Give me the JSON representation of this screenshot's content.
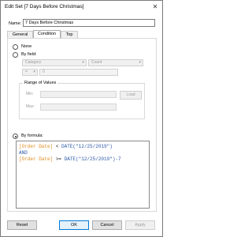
{
  "window": {
    "title": "Edit Set [7 Days Before Christmas]",
    "close_glyph": "✕"
  },
  "name": {
    "label": "Name:",
    "value": "7 Days Before Christmas"
  },
  "tabs": [
    {
      "label": "General",
      "active": false
    },
    {
      "label": "Condition",
      "active": true
    },
    {
      "label": "Top",
      "active": false
    }
  ],
  "condition": {
    "options": [
      {
        "label": "None",
        "checked": false
      },
      {
        "label": "By field:",
        "checked": false
      },
      {
        "label": "By formula:",
        "checked": true
      }
    ],
    "by_field": {
      "field_select": "Category",
      "aggregation_select": "Count",
      "operator_select": "=",
      "value": "0"
    },
    "range": {
      "title": "Range of Values",
      "min_label": "Min:",
      "max_label": "Max:",
      "load_button": "Load"
    },
    "formula": {
      "line1": {
        "field": "[Order Date]",
        "op": " < ",
        "func": "DATE(\"12/25/2019\")"
      },
      "line2": {
        "keyword": "AND"
      },
      "line3": {
        "field": "[Order Date]",
        "op": " >= ",
        "func": "DATE(\"12/25/2019\")-7"
      }
    }
  },
  "footer": {
    "reset": "Reset",
    "ok": "OK",
    "cancel": "Cancel",
    "apply": "Apply"
  },
  "colors": {
    "field": "#e08a1e",
    "function": "#2b58a8",
    "accent": "#0078d7"
  },
  "icons": {
    "close": "close-icon",
    "dropdown": "chevron-down-icon"
  }
}
